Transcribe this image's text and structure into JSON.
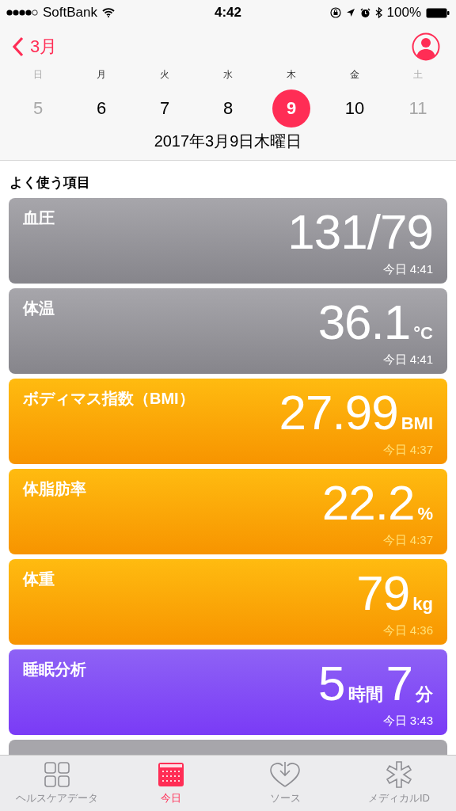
{
  "status_bar": {
    "carrier": "SoftBank",
    "time": "4:42",
    "battery": "100%"
  },
  "nav": {
    "back": "3月"
  },
  "week": [
    {
      "weekday": "日",
      "day": "5",
      "selected": false,
      "weekend": true
    },
    {
      "weekday": "月",
      "day": "6",
      "selected": false,
      "weekend": false
    },
    {
      "weekday": "火",
      "day": "7",
      "selected": false,
      "weekend": false
    },
    {
      "weekday": "水",
      "day": "8",
      "selected": false,
      "weekend": false
    },
    {
      "weekday": "木",
      "day": "9",
      "selected": true,
      "weekend": false
    },
    {
      "weekday": "金",
      "day": "10",
      "selected": false,
      "weekend": false
    },
    {
      "weekday": "土",
      "day": "11",
      "selected": false,
      "weekend": true
    }
  ],
  "date": "2017年3月9日木曜日",
  "section_title": "よく使う項目",
  "cards": [
    {
      "kind": "vitals",
      "title": "血圧",
      "value": [
        {
          "kind": "num",
          "text": "131/79"
        }
      ],
      "time": "今日 4:41"
    },
    {
      "kind": "vitals",
      "title": "体温",
      "value": [
        {
          "kind": "num",
          "text": "36.1"
        },
        {
          "kind": "unit",
          "text": "°C"
        }
      ],
      "time": "今日 4:41"
    },
    {
      "kind": "body",
      "title": "ボディマス指数（BMI）",
      "value": [
        {
          "kind": "num",
          "text": "27.99"
        },
        {
          "kind": "unit",
          "text": "BMI"
        }
      ],
      "time": "今日 4:37"
    },
    {
      "kind": "body",
      "title": "体脂肪率",
      "value": [
        {
          "kind": "num",
          "text": "22.2"
        },
        {
          "kind": "unit",
          "text": "%"
        }
      ],
      "time": "今日 4:37"
    },
    {
      "kind": "body",
      "title": "体重",
      "value": [
        {
          "kind": "num",
          "text": "79"
        },
        {
          "kind": "unit",
          "text": "kg"
        }
      ],
      "time": "今日 4:36"
    },
    {
      "kind": "sleep",
      "title": "睡眠分析",
      "value": [
        {
          "kind": "num",
          "text": "5"
        },
        {
          "kind": "unit",
          "text": "時間"
        },
        {
          "kind": "num",
          "text": "7"
        },
        {
          "kind": "unit",
          "text": "分"
        }
      ],
      "time": "今日 3:43"
    }
  ],
  "tabs": [
    {
      "kind": "grid",
      "label": "ヘルスケアデータ",
      "selected": false
    },
    {
      "kind": "calendar",
      "label": "今日",
      "selected": true
    },
    {
      "kind": "heart",
      "label": "ソース",
      "selected": false
    },
    {
      "kind": "asterisk",
      "label": "メディカルID",
      "selected": false
    }
  ]
}
